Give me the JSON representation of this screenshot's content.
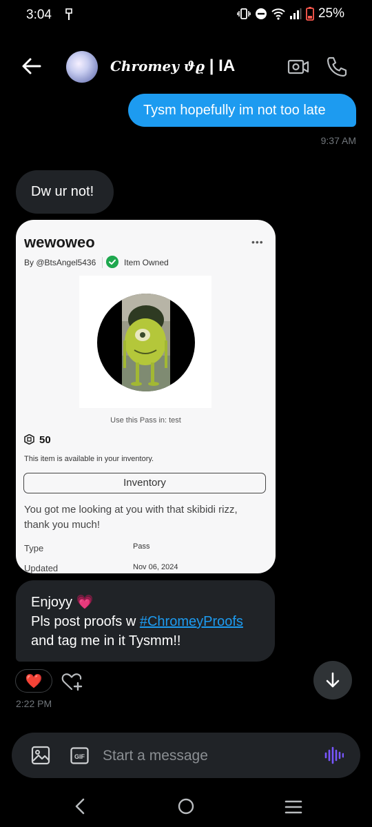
{
  "status": {
    "time": "3:04",
    "battery": "25%"
  },
  "header": {
    "contact_name_script": "Chromey ϑϱ",
    "contact_name_suffix": " | IA"
  },
  "messages": {
    "outgoing_text": "Tysm hopefully im not too late",
    "outgoing_time": "9:37 AM",
    "incoming_1_text": "Dw ur not!",
    "incoming_2_line1": "Enjoyy 💗",
    "incoming_2_line2_prefix": "Pls post proofs w ",
    "incoming_2_hashtag": "#ChromeyProofs",
    "incoming_2_line3": "and tag me in it Tysmm!!",
    "reaction": "❤️",
    "incoming_time": "2:22 PM"
  },
  "card": {
    "title": "wewoweo",
    "more": "•••",
    "by": "By @BtsAngel5436",
    "owned_label": "Item Owned",
    "use_pass": "Use this Pass in: test",
    "price": "50",
    "availability": "This item is available in your inventory.",
    "inventory_button": "Inventory",
    "description": "You got me looking at you with that skibidi rizz, thank you much!",
    "type_key": "Type",
    "type_value": "Pass",
    "updated_key": "Updated",
    "updated_value": "Nov 06, 2024"
  },
  "composer": {
    "placeholder": "Start a message",
    "gif_label": "GIF"
  },
  "colors": {
    "accent": "#1d9bf0",
    "bubble_in": "#202327",
    "voice": "#7856ff",
    "owned": "#1fa84f"
  }
}
